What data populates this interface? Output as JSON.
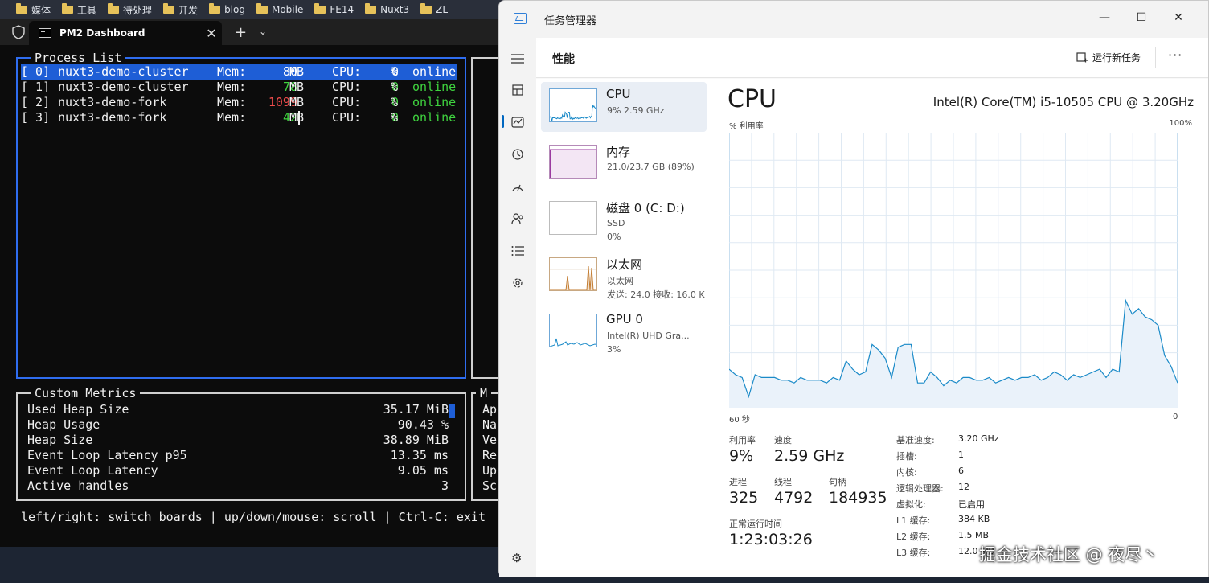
{
  "bookmarks": [
    "媒体",
    "工具",
    "待处理",
    "开发",
    "blog",
    "Mobile",
    "FE14",
    "Nuxt3",
    "ZL"
  ],
  "terminal": {
    "tab_title": "PM2 Dashboard",
    "tab_close": "✕",
    "new_tab": "+",
    "tab_menu": "⌄",
    "process_list": {
      "title": "Process List",
      "rows": [
        {
          "idx": "[ 0]",
          "name": "nuxt3-demo-cluster",
          "mem_label": "Mem:",
          "mem": "80",
          "mem_unit": "MB",
          "cpu_label": "CPU:",
          "cpu": "0",
          "cpu_unit": "%",
          "status": "online"
        },
        {
          "idx": "[ 1]",
          "name": "nuxt3-demo-cluster",
          "mem_label": "Mem:",
          "mem": "78",
          "mem_unit": "MB",
          "cpu_label": "CPU:",
          "cpu": "0",
          "cpu_unit": "%",
          "status": "online"
        },
        {
          "idx": "[ 2]",
          "name": "nuxt3-demo-fork",
          "mem_label": "Mem:",
          "mem": "1099",
          "mem_unit": "MB",
          "cpu_label": "CPU:",
          "cpu": "0",
          "cpu_unit": "%",
          "status": "online"
        },
        {
          "idx": "[ 3]",
          "name": "nuxt3-demo-fork",
          "mem_label": "Mem:",
          "mem": "42",
          "mem_unit": "MB",
          "cpu_label": "CPU:",
          "cpu": "0",
          "cpu_unit": "%",
          "status": "online"
        }
      ]
    },
    "side_box_title_partial": "M",
    "custom_metrics": {
      "title": "Custom Metrics",
      "rows": [
        {
          "label": "Used Heap Size",
          "value": "35.17 MiB"
        },
        {
          "label": "Heap Usage",
          "value": "90.43 %"
        },
        {
          "label": "Heap Size",
          "value": "38.89 MiB"
        },
        {
          "label": "Event Loop Latency p95",
          "value": "13.35 ms"
        },
        {
          "label": "Event Loop Latency",
          "value": "9.05 ms"
        },
        {
          "label": "Active handles",
          "value": "3"
        }
      ]
    },
    "metadata_partial": [
      "Ap",
      "Na",
      "Ve",
      "Re",
      "Up",
      "Sc"
    ],
    "footer": "left/right: switch boards | up/down/mouse: scroll | Ctrl-C: exit"
  },
  "taskmgr": {
    "window_title": "任务管理器",
    "minimize": "—",
    "maximize": "☐",
    "close": "✕",
    "page_title": "性能",
    "run_new_task": "运行新任务",
    "more": "···",
    "resources": [
      {
        "name": "CPU",
        "sub1": "9% 2.59 GHz",
        "sub2": ""
      },
      {
        "name": "内存",
        "sub1": "21.0/23.7 GB (89%)",
        "sub2": ""
      },
      {
        "name": "磁盘 0 (C: D:)",
        "sub1": "SSD",
        "sub2": "0%"
      },
      {
        "name": "以太网",
        "sub1": "以太网",
        "sub2": "发送: 24.0 接收: 16.0 K"
      },
      {
        "name": "GPU 0",
        "sub1": "Intel(R) UHD Gra...",
        "sub2": "3%"
      }
    ],
    "cpu_heading": "CPU",
    "cpu_model": "Intel(R) Core(TM) i5-10505 CPU @ 3.20GHz",
    "graph_label": "% 利用率",
    "graph_max": "100%",
    "time_left": "60 秒",
    "time_right": "0",
    "stats": {
      "util_label": "利用率",
      "util": "9%",
      "speed_label": "速度",
      "speed": "2.59 GHz",
      "proc_label": "进程",
      "proc": "325",
      "thread_label": "线程",
      "thread": "4792",
      "handle_label": "句柄",
      "handle": "184935",
      "uptime_label": "正常运行时间",
      "uptime": "1:23:03:26"
    },
    "specs": [
      {
        "label": "基准速度:",
        "value": "3.20 GHz"
      },
      {
        "label": "插槽:",
        "value": "1"
      },
      {
        "label": "内核:",
        "value": "6"
      },
      {
        "label": "逻辑处理器:",
        "value": "12"
      },
      {
        "label": "虚拟化:",
        "value": "已启用"
      },
      {
        "label": "L1 缓存:",
        "value": "384 KB"
      },
      {
        "label": "L2 缓存:",
        "value": "1.5 MB"
      },
      {
        "label": "L3 缓存:",
        "value": "12.0 MB"
      }
    ],
    "cpu_series": [
      14,
      12,
      11,
      4,
      12,
      11,
      11,
      11,
      10,
      10,
      9,
      11,
      10,
      10,
      10,
      9,
      11,
      10,
      17,
      14,
      12,
      13,
      23,
      21,
      18,
      11,
      22,
      23,
      23,
      9,
      9,
      13,
      11,
      8,
      10,
      9,
      11,
      11,
      10,
      10,
      11,
      9,
      10,
      11,
      10,
      11,
      11,
      12,
      10,
      11,
      13,
      12,
      10,
      12,
      11,
      12,
      13,
      14,
      11,
      14,
      13,
      39,
      34,
      36,
      33,
      32,
      30,
      19,
      15,
      9
    ],
    "colors": {
      "cpu_line": "#1a8ac8",
      "cpu_fill": "#eaf2fa",
      "mem_line": "#9b3aa0",
      "net_line": "#c27a2e",
      "terminal_selection": "#1e5ed6",
      "terminal_green": "#3fd43f",
      "terminal_red": "#f14c4c"
    }
  },
  "watermark": "掘金技术社区 @ 夜尽丶"
}
